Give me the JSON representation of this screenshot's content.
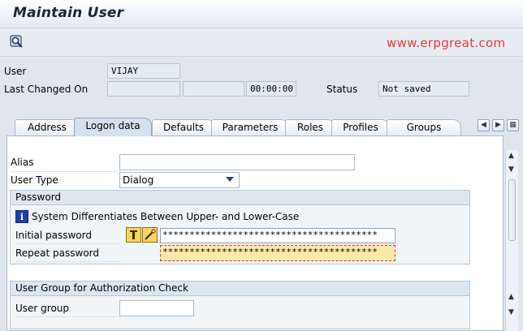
{
  "window": {
    "title": "Maintain User"
  },
  "toolbar": {
    "watermark": "www.erpgreat.com"
  },
  "header": {
    "user_label": "User",
    "user_value": "VIJAY",
    "last_changed_label": "Last Changed On",
    "last_changed_date1": "",
    "last_changed_date2": "",
    "last_changed_time": "00:00:00",
    "status_label": "Status",
    "status_value": "Not saved"
  },
  "tabs": [
    {
      "label": "Address"
    },
    {
      "label": "Logon data"
    },
    {
      "label": "Defaults"
    },
    {
      "label": "Parameters"
    },
    {
      "label": "Roles"
    },
    {
      "label": "Profiles"
    },
    {
      "label": "Groups"
    }
  ],
  "logon": {
    "alias_label": "Alias",
    "alias_value": "",
    "user_type_label": "User Type",
    "user_type_value": "Dialog"
  },
  "password": {
    "group_title": "Password",
    "info_text": "System Differentiates Between Upper- and Lower-Case",
    "initial_label": "Initial password",
    "initial_value": "****************************************",
    "repeat_label": "Repeat password",
    "repeat_value": "****************************************"
  },
  "user_group": {
    "group_title": "User Group for Authorization Check",
    "label": "User group",
    "value": ""
  },
  "colors": {
    "accent": "#1f3fa8",
    "highlight": "#fbe9a7",
    "watermark": "#e23b3b"
  }
}
